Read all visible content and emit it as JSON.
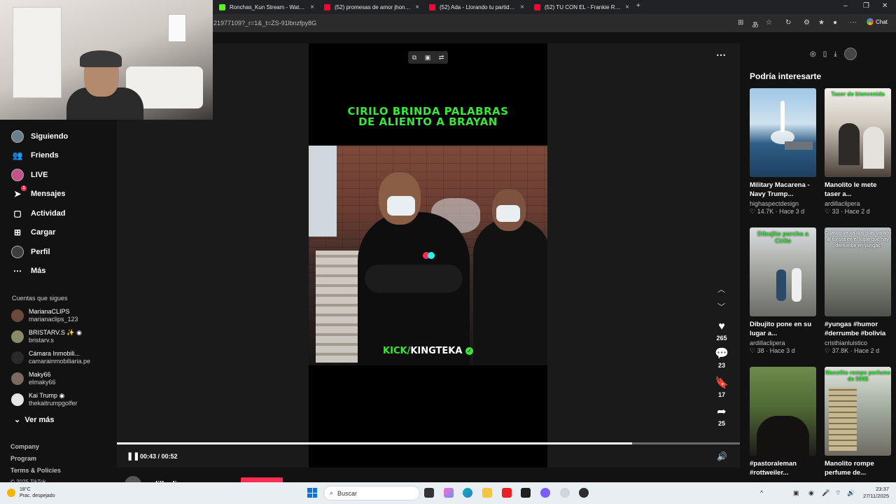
{
  "browser": {
    "tabs": [
      {
        "title": "Ronchas_Kun Stream - Watch Liv",
        "color": "#53fc18"
      },
      {
        "title": "(52) promesas de amor jhonny fi",
        "color": "#ff0033"
      },
      {
        "title": "(52) Ada - Llorando tu partida.el",
        "color": "#ff0033"
      },
      {
        "title": "(52) TU CON EL - Frankie Ruiz (Le",
        "color": "#ff0033"
      }
    ],
    "url": "21977109?_r=1&_t=ZS-91lbnzfpy8G",
    "chat_label": "Chat"
  },
  "sidebar": {
    "nav": [
      {
        "label": "Siguiendo",
        "icon": "following-avatar-icon"
      },
      {
        "label": "Friends",
        "icon": "friends-icon"
      },
      {
        "label": "LIVE",
        "icon": "live-icon"
      },
      {
        "label": "Mensajes",
        "icon": "messages-icon",
        "badge": "1"
      },
      {
        "label": "Actividad",
        "icon": "activity-icon"
      },
      {
        "label": "Cargar",
        "icon": "upload-icon"
      },
      {
        "label": "Perfil",
        "icon": "profile-icon"
      },
      {
        "label": "Más",
        "icon": "more-icon"
      }
    ],
    "following_title": "Cuentas que sigues",
    "accounts": [
      {
        "name": "MarianaCLIPS",
        "handle": "marianaclips_123"
      },
      {
        "name": "BRISTARV.S ✨ ◉",
        "handle": "bristarv.s"
      },
      {
        "name": "Cámara Inmobili...",
        "handle": "camarainmobiliaria.pe"
      },
      {
        "name": "Maky66",
        "handle": "elmaky66"
      },
      {
        "name": "Kai Trump ◉",
        "handle": "thekaitrumpgolfer"
      }
    ],
    "see_more": "Ver más",
    "footer": [
      "Company",
      "Program",
      "Terms & Policies",
      "© 2025 TikTok"
    ]
  },
  "video": {
    "title_line1": "CIRILO BRINDA PALABRAS",
    "title_line2": "DE ALIENTO A BRAYAN",
    "watermark_green": "KICK/",
    "watermark_white": "KINGTEKA",
    "likes": "265",
    "comments": "23",
    "saves": "17",
    "shares": "25",
    "time": "00:43 / 00:52",
    "progress": 0.827,
    "author": "ardillaclipera"
  },
  "recommendations": {
    "title": "Podría interesarte",
    "items": [
      {
        "caption": "Military Macarena - Navy Trump...",
        "cap1": "Military Macarena -",
        "cap2": "Navy Trump...",
        "user": "highaspectdesign",
        "likes": "14.7K",
        "age": "Hace 3 d",
        "overlay": "",
        "theme": "sea"
      },
      {
        "caption": "Manolito le mete taser a...",
        "cap1": "Manolito le mete",
        "cap2": "taser a...",
        "user": "ardillaclipera",
        "likes": "33",
        "age": "Hace 2 d",
        "overlay": "Taser de bienvenida",
        "theme": "room"
      },
      {
        "caption": "Dibujito pone en su lugar a...",
        "cap1": "Dibujito pone en su",
        "cap2": "lugar a...",
        "user": "ardillaclipera",
        "likes": "38",
        "age": "Hace 3 d",
        "overlay": "Dibujito parcha a Cirilo",
        "theme": "street"
      },
      {
        "caption": "#yungas #humor #derrumbe #bolivia",
        "cap1": "#yungas #humor",
        "cap2": "#derrumbe #bolivia",
        "user": "cristhianluistico",
        "likes": "37.8K",
        "age": "Hace 2 d",
        "overlay": "Cuando ya va dos días varado al turista en el lugar que hay derrumbe en yungas",
        "theme": "crowd"
      },
      {
        "caption": "#pastoraleman #rottweiler...",
        "cap1": "#pastoraleman",
        "cap2": "#rottweiler...",
        "user": "",
        "likes": "",
        "age": "",
        "overlay": "",
        "theme": "garden"
      },
      {
        "caption": "Manolito rompe perfume de...",
        "cap1": "Manolito rompe",
        "cap2": "perfume de...",
        "user": "",
        "likes": "",
        "age": "",
        "overlay": "Manolito rompe perfume de 500$",
        "theme": "shop"
      }
    ]
  },
  "taskbar": {
    "temp": "18°C",
    "weather": "Prac. despejado",
    "search_placeholder": "Buscar",
    "time": "23:37",
    "date": "27/11/2025"
  }
}
